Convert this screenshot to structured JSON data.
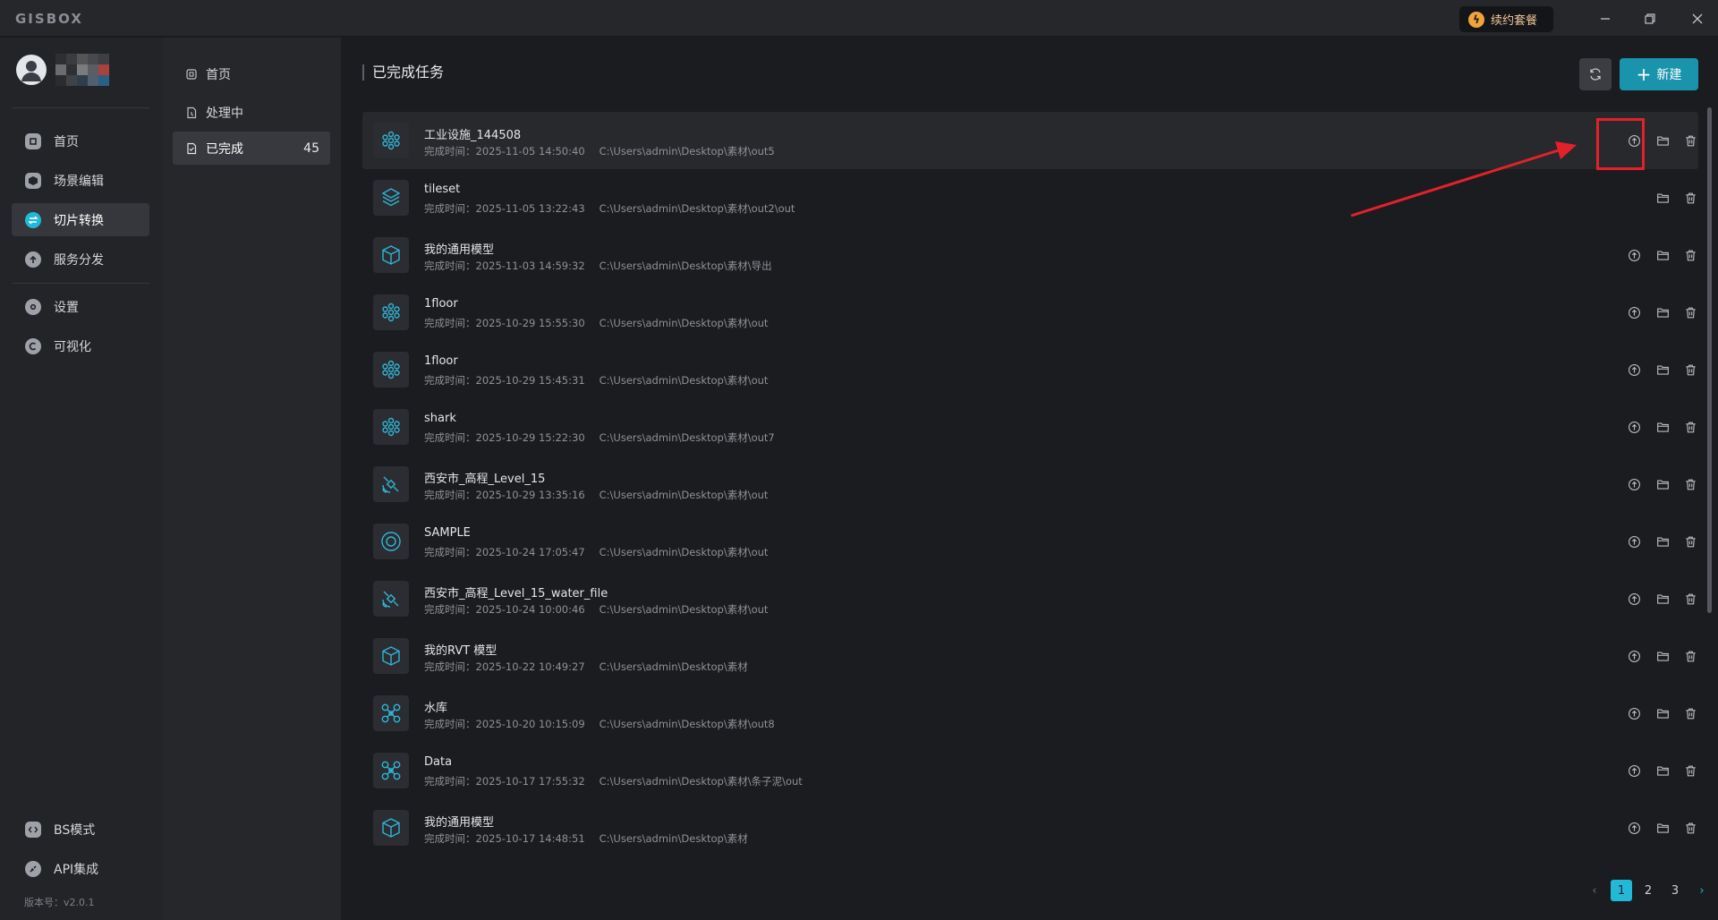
{
  "app": {
    "logo": "GISBOX",
    "renew_label": "续约套餐",
    "version": "版本号：v2.0.1"
  },
  "sidebar": {
    "items": [
      {
        "label": "首页",
        "icon": "home-icon"
      },
      {
        "label": "场景编辑",
        "icon": "cube-icon"
      },
      {
        "label": "切片转换",
        "icon": "convert-icon"
      },
      {
        "label": "服务分发",
        "icon": "upload-icon"
      },
      {
        "label": "设置",
        "icon": "gear-icon"
      },
      {
        "label": "可视化",
        "icon": "visual-icon"
      },
      {
        "label": "BS模式",
        "icon": "code-icon"
      },
      {
        "label": "API集成",
        "icon": "api-icon"
      }
    ]
  },
  "subnav": {
    "items": [
      {
        "label": "首页"
      },
      {
        "label": "处理中"
      },
      {
        "label": "已完成",
        "count": "45"
      }
    ]
  },
  "main": {
    "title": "已完成任务",
    "new_label": "新建"
  },
  "tasks": [
    {
      "name": "工业设施_144508",
      "time": "完成时间：2025-11-05 14:50:40",
      "path": "C:\\Users\\admin\\Desktop\\素材\\out5",
      "icon": "flower"
    },
    {
      "name": "tileset",
      "time": "完成时间：2025-11-05 13:22:43",
      "path": "C:\\Users\\admin\\Desktop\\素材\\out2\\out",
      "icon": "layers"
    },
    {
      "name": "我的通用模型",
      "time": "完成时间：2025-11-03 14:59:32",
      "path": "C:\\Users\\admin\\Desktop\\素材\\导出",
      "icon": "box"
    },
    {
      "name": "1floor",
      "time": "完成时间：2025-10-29 15:55:30",
      "path": "C:\\Users\\admin\\Desktop\\素材\\out",
      "icon": "flower"
    },
    {
      "name": "1floor",
      "time": "完成时间：2025-10-29 15:45:31",
      "path": "C:\\Users\\admin\\Desktop\\素材\\out",
      "icon": "flower"
    },
    {
      "name": "shark",
      "time": "完成时间：2025-10-29 15:22:30",
      "path": "C:\\Users\\admin\\Desktop\\素材\\out7",
      "icon": "flower"
    },
    {
      "name": "西安市_高程_Level_15",
      "time": "完成时间：2025-10-29 13:35:16",
      "path": "C:\\Users\\admin\\Desktop\\素材\\out",
      "icon": "satellite"
    },
    {
      "name": "SAMPLE",
      "time": "完成时间：2025-10-24 17:05:47",
      "path": "C:\\Users\\admin\\Desktop\\素材\\out",
      "icon": "target"
    },
    {
      "name": "西安市_高程_Level_15_water_file",
      "time": "完成时间：2025-10-24 10:00:46",
      "path": "C:\\Users\\admin\\Desktop\\素材\\out",
      "icon": "satellite"
    },
    {
      "name": "我的RVT 模型",
      "time": "完成时间：2025-10-22 10:49:27",
      "path": "C:\\Users\\admin\\Desktop\\素材",
      "icon": "box"
    },
    {
      "name": "水库",
      "time": "完成时间：2025-10-20 10:15:09",
      "path": "C:\\Users\\admin\\Desktop\\素材\\out8",
      "icon": "drone"
    },
    {
      "name": "Data",
      "time": "完成时间：2025-10-17 17:55:32",
      "path": "C:\\Users\\admin\\Desktop\\素材\\条子泥\\out",
      "icon": "drone"
    },
    {
      "name": "我的通用模型",
      "time": "完成时间：2025-10-17 14:48:51",
      "path": "C:\\Users\\admin\\Desktop\\素材",
      "icon": "box"
    }
  ],
  "pagination": {
    "pages": [
      "1",
      "2",
      "3"
    ],
    "current": "1"
  },
  "colors": {
    "accent": "#22b8d8",
    "primary_button": "#1a93ad",
    "annotation": "#e3212b"
  }
}
